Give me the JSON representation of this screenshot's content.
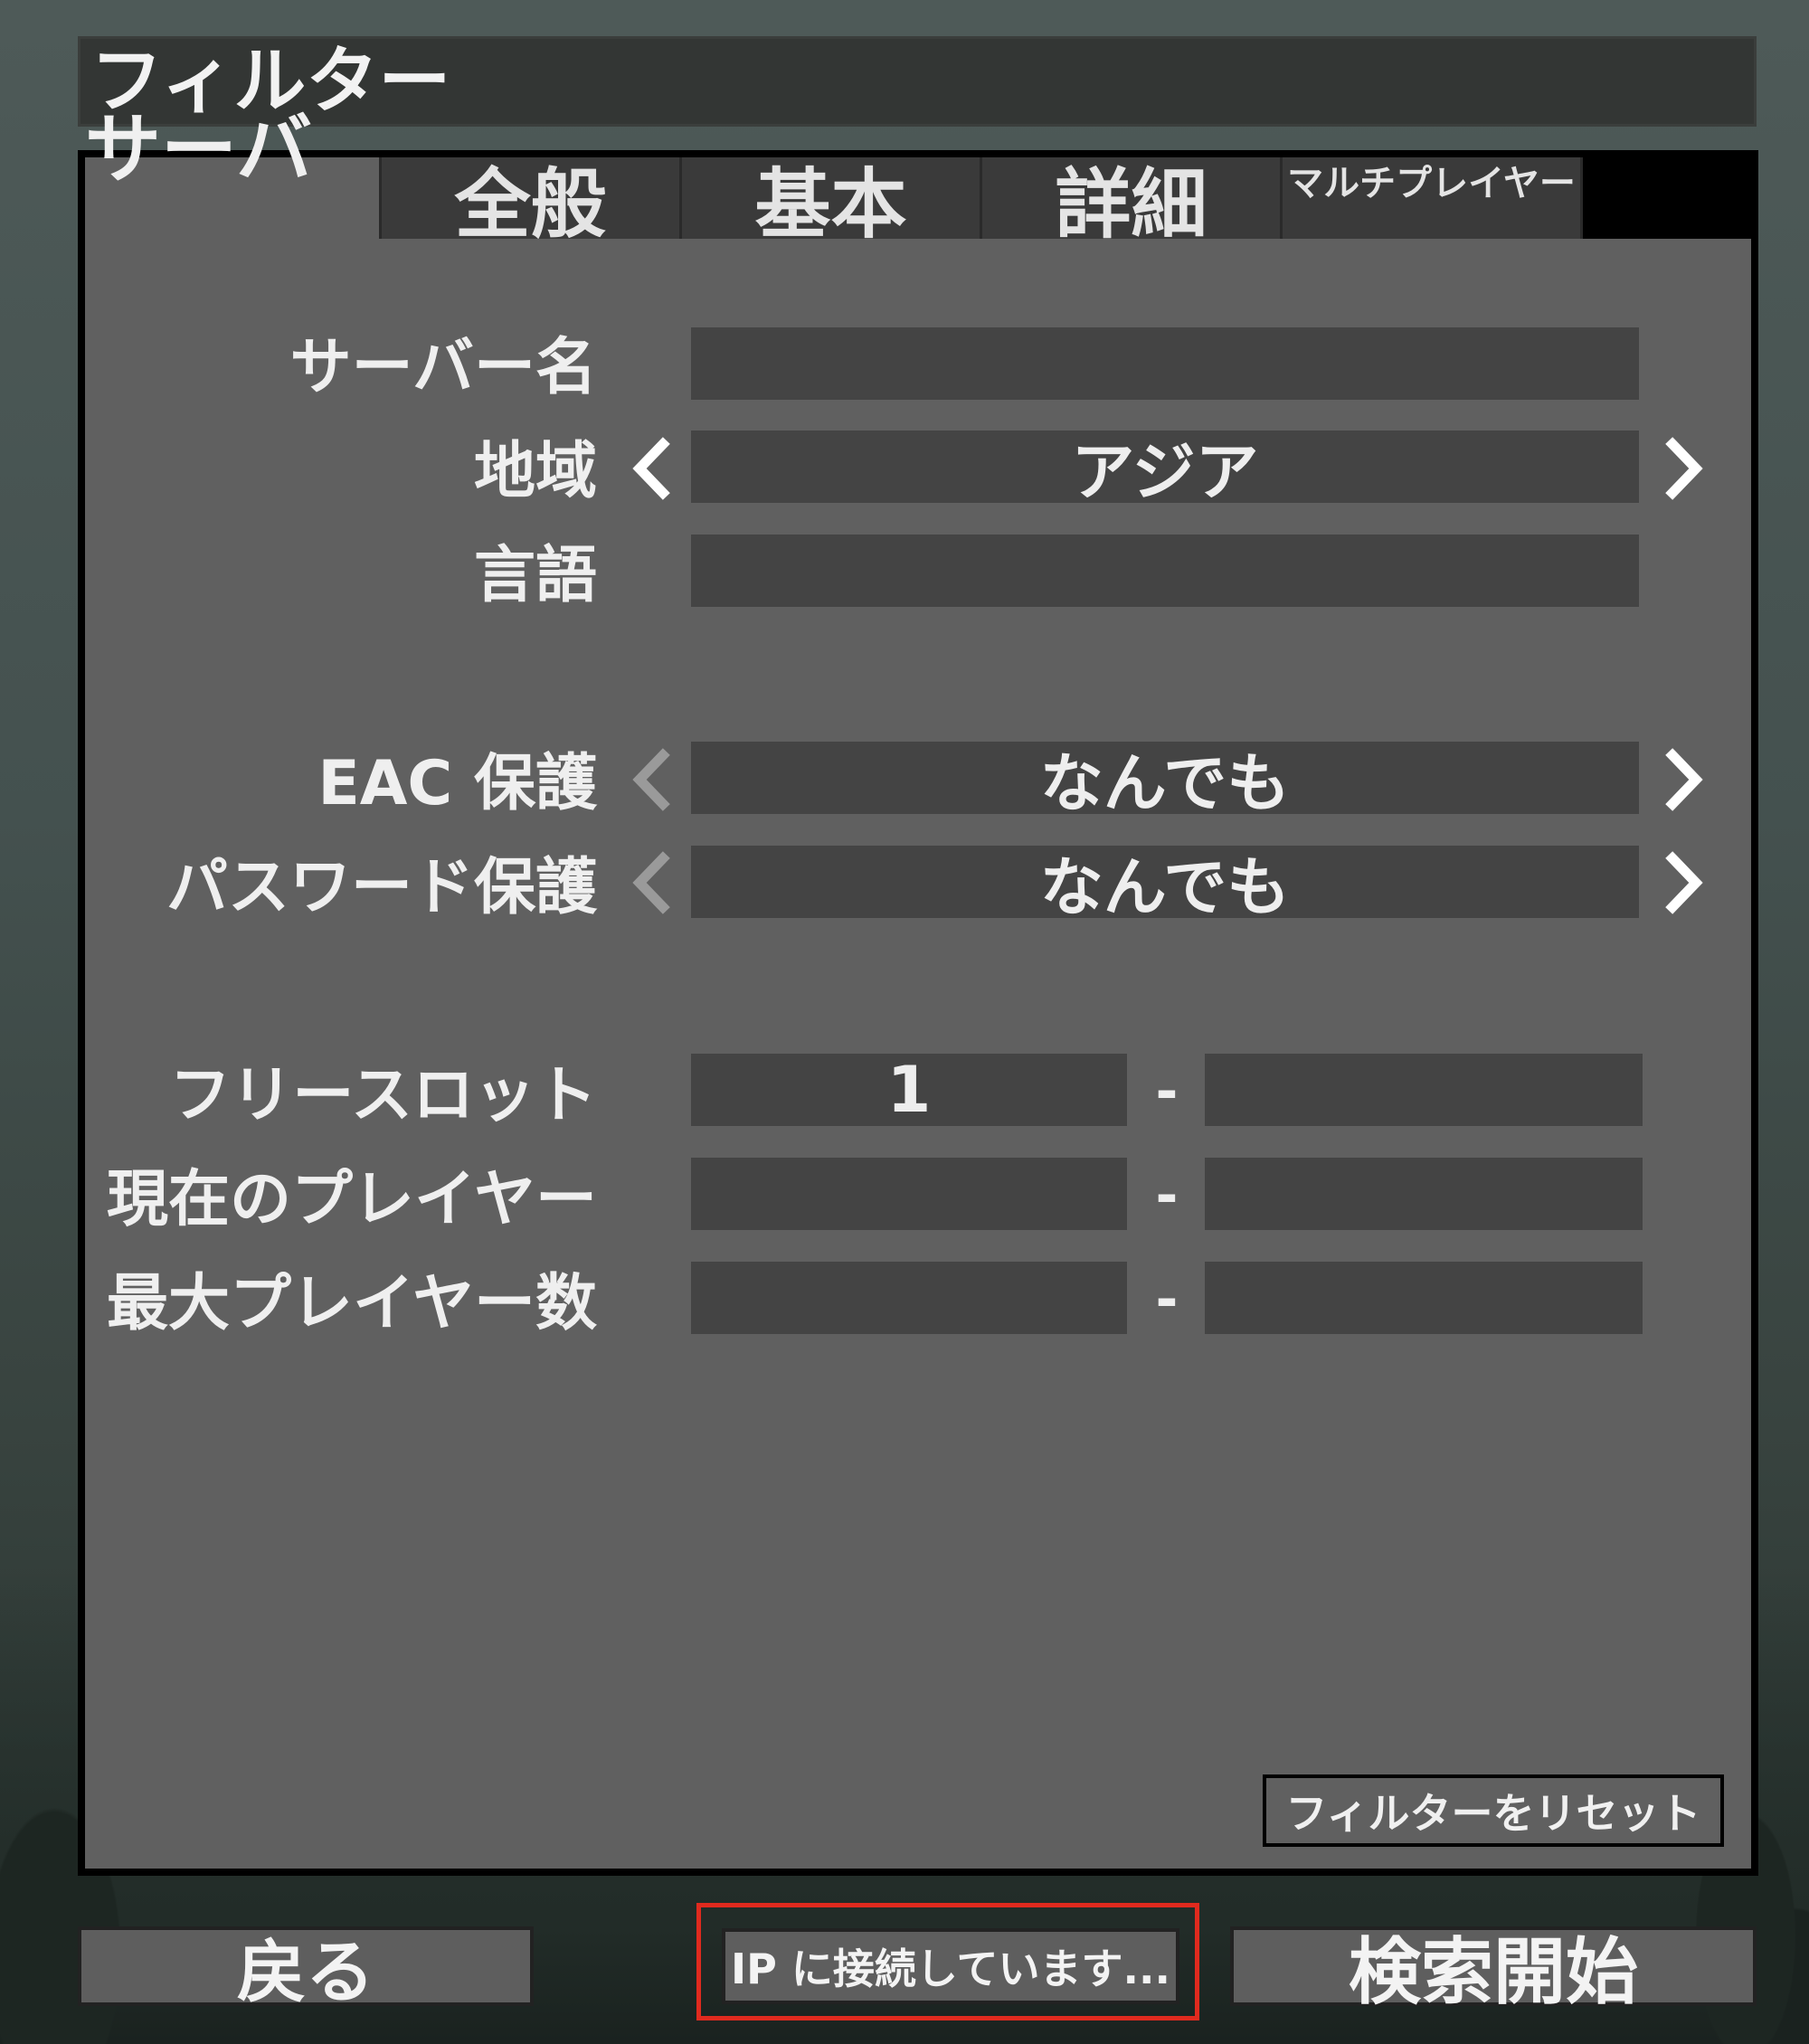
{
  "title": "フィルター",
  "tabs": [
    {
      "label": "サーバー",
      "active": true
    },
    {
      "label": "全般",
      "active": false
    },
    {
      "label": "基本",
      "active": false
    },
    {
      "label": "詳細",
      "active": false
    },
    {
      "label": "マルチプレイヤー",
      "active": false
    }
  ],
  "fields": {
    "server_name": {
      "label": "サーバー名",
      "value": ""
    },
    "region": {
      "label": "地域",
      "value": "アジア"
    },
    "language": {
      "label": "言語",
      "value": ""
    },
    "eac": {
      "label": "EAC 保護",
      "value": "なんでも"
    },
    "password": {
      "label": "パスワード保護",
      "value": "なんでも"
    },
    "free_slots": {
      "label": "フリースロット",
      "min": "1",
      "max": "",
      "separator": "-"
    },
    "current_players": {
      "label": "現在のプレイヤー",
      "min": "",
      "max": "",
      "separator": "-"
    },
    "max_players": {
      "label": "最大プレイヤー数",
      "min": "",
      "max": "",
      "separator": "-"
    }
  },
  "buttons": {
    "reset": "フィルターをリセット",
    "back": "戻る",
    "connect_ip": "IP に接続しています...",
    "search": "検索開始"
  },
  "colors": {
    "panel": "#606060",
    "field": "#444444",
    "highlight": "#e02a1e",
    "arrow_enabled": "#ffffff",
    "arrow_disabled": "#9a9a9a"
  }
}
